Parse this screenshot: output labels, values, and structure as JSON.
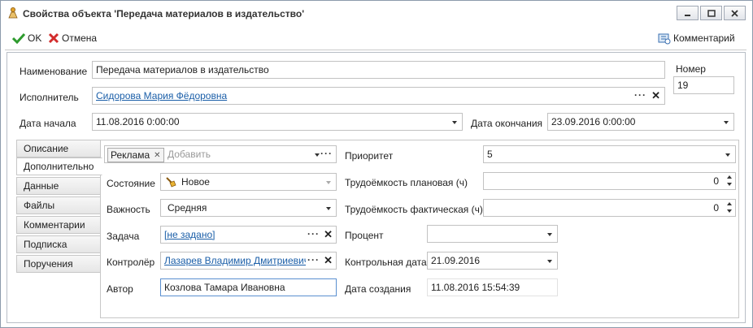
{
  "window": {
    "title": "Свойства объекта 'Передача материалов в издательство'"
  },
  "toolbar": {
    "ok_label": "OK",
    "cancel_label": "Отмена",
    "comment_label": "Комментарий"
  },
  "header": {
    "name_label": "Наименование",
    "name_value": "Передача материалов в издательство",
    "number_label": "Номер",
    "number_value": "19",
    "executor_label": "Исполнитель",
    "executor_value": "Сидорова Мария Фёдоровна",
    "start_label": "Дата начала",
    "start_value": "11.08.2016 0:00:00",
    "end_label": "Дата окончания",
    "end_value": "23.09.2016 0:00:00"
  },
  "tabs": [
    {
      "label": "Описание"
    },
    {
      "label": "Дополнительно"
    },
    {
      "label": "Данные"
    },
    {
      "label": "Файлы"
    },
    {
      "label": "Комментарии"
    },
    {
      "label": "Подписка"
    },
    {
      "label": "Поручения"
    }
  ],
  "extra": {
    "tag_chip": "Реклама",
    "tag_placeholder": "Добавить",
    "state_label": "Состояние",
    "state_value": "Новое",
    "importance_label": "Важность",
    "importance_value": "Средняя",
    "task_label": "Задача",
    "task_value": "[не задано]",
    "controller_label": "Контролёр",
    "controller_value": "Лазарев Владимир Дмитриевич",
    "author_label": "Автор",
    "author_value": "Козлова Тамара Ивановна",
    "priority_label": "Приоритет",
    "priority_value": "5",
    "planned_label": "Трудоёмкость плановая (ч)",
    "planned_value": "0",
    "actual_label": "Трудоёмкость фактическая (ч)",
    "actual_value": "0",
    "percent_label": "Процент",
    "percent_value": "",
    "control_date_label": "Контрольная дата",
    "control_date_value": "21.09.2016",
    "created_label": "Дата создания",
    "created_value": "11.08.2016 15:54:39"
  },
  "colors": {
    "link": "#1a5ea8",
    "ok_check": "#2e9b2e",
    "cancel_x": "#d22c2c",
    "focus_border": "#5a8fd0"
  }
}
